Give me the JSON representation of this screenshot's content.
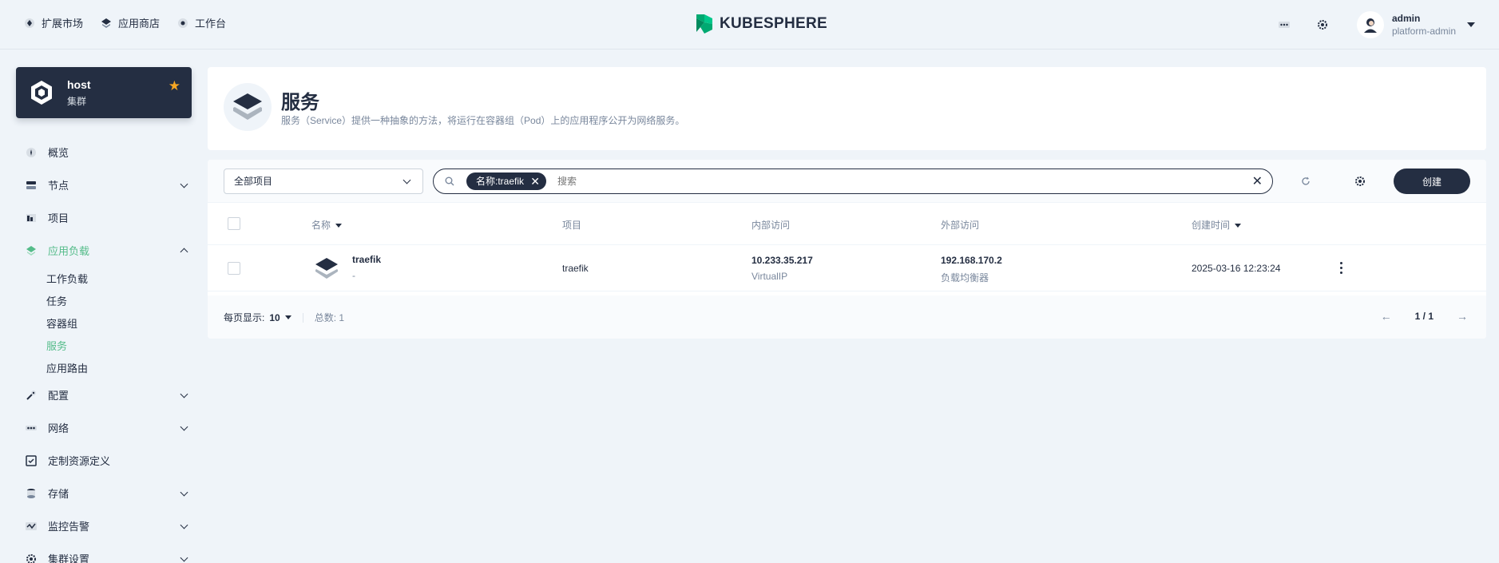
{
  "topbar": {
    "nav": [
      {
        "label": "扩展市场",
        "icon": "extensions-icon"
      },
      {
        "label": "应用商店",
        "icon": "app-store-icon"
      },
      {
        "label": "工作台",
        "icon": "workbench-icon"
      }
    ],
    "logo_text": "KUBESPHERE",
    "user": {
      "name": "admin",
      "role": "platform-admin"
    }
  },
  "cluster": {
    "name": "host",
    "type": "集群"
  },
  "sidebar": {
    "items": [
      {
        "label": "概览"
      },
      {
        "label": "节点"
      },
      {
        "label": "项目"
      },
      {
        "label": "应用负载"
      },
      {
        "label": "配置"
      },
      {
        "label": "网络"
      },
      {
        "label": "定制资源定义"
      },
      {
        "label": "存储"
      },
      {
        "label": "监控告警"
      },
      {
        "label": "集群设置"
      }
    ],
    "workload_sub": [
      {
        "label": "工作负载"
      },
      {
        "label": "任务"
      },
      {
        "label": "容器组"
      },
      {
        "label": "服务"
      },
      {
        "label": "应用路由"
      }
    ]
  },
  "header": {
    "title": "服务",
    "description": "服务（Service）提供一种抽象的方法，将运行在容器组（Pod）上的应用程序公开为网络服务。"
  },
  "toolbar": {
    "project_select": "全部项目",
    "filter_tag": "名称:traefik",
    "search_placeholder": "搜索",
    "create_label": "创建"
  },
  "table": {
    "columns": {
      "name": "名称",
      "project": "项目",
      "internal": "内部访问",
      "external": "外部访问",
      "created": "创建时间"
    },
    "rows": [
      {
        "name": "traefik",
        "desc": "-",
        "project": "traefik",
        "internal_ip": "10.233.35.217",
        "internal_type": "VirtualIP",
        "external_ip": "192.168.170.2",
        "external_type": "负载均衡器",
        "created": "2025-03-16 12:23:24"
      }
    ]
  },
  "footer": {
    "per_page_label": "每页显示:",
    "per_page_value": "10",
    "total": "总数: 1",
    "page": "1 / 1"
  },
  "colors": {
    "accent": "#55bc8a",
    "dark": "#242e42",
    "muted": "#79879c",
    "star": "#f5a623"
  }
}
